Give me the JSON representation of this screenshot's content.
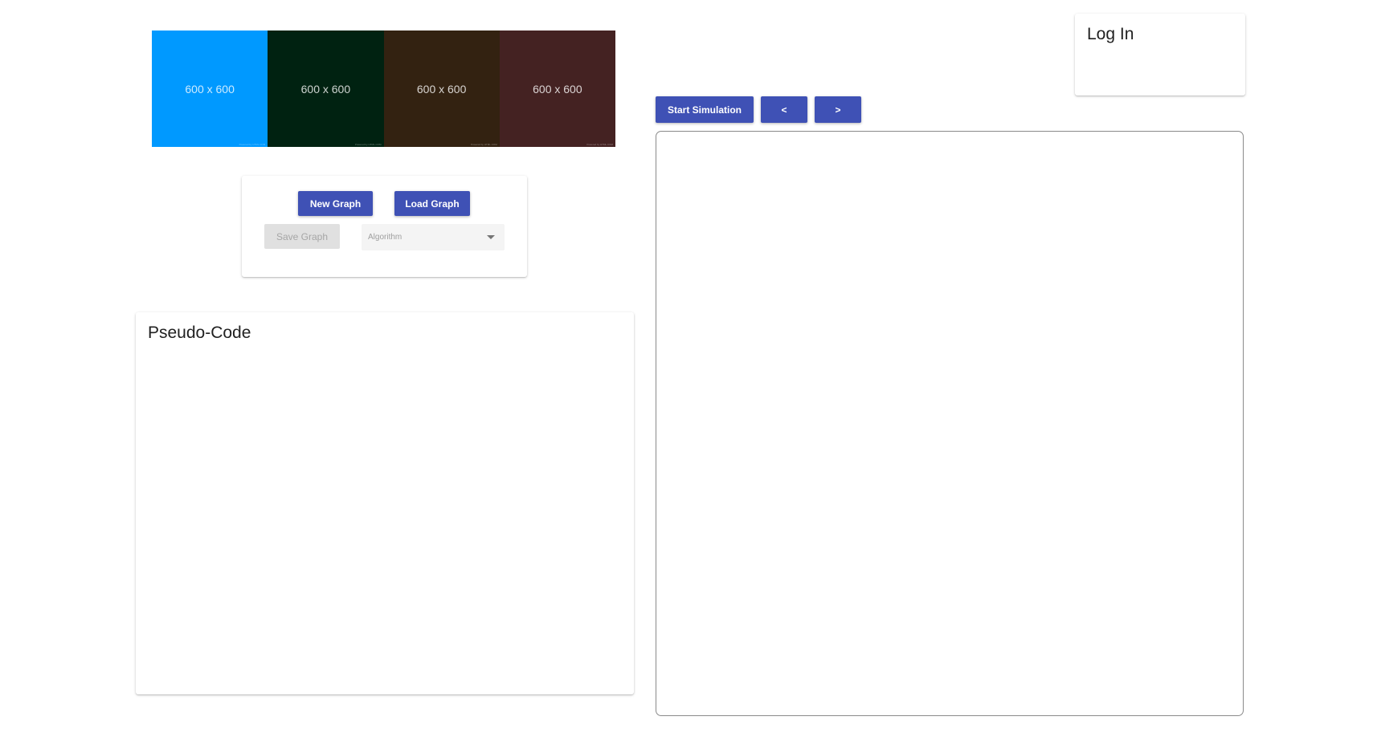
{
  "banner": {
    "tiles": [
      {
        "label": "600 x 600",
        "color": "#0099ff"
      },
      {
        "label": "600 x 600",
        "color": "#002211"
      },
      {
        "label": "600 x 600",
        "color": "#332211"
      },
      {
        "label": "600 x 600",
        "color": "#442222"
      }
    ],
    "credit": "Powered by HTML.COM"
  },
  "controls": {
    "new_graph_label": "New Graph",
    "load_graph_label": "Load Graph",
    "save_graph_label": "Save Graph",
    "algorithm_placeholder": "Algorithm"
  },
  "pseudo_code": {
    "title": "Pseudo-Code"
  },
  "login": {
    "title": "Log In"
  },
  "simulation": {
    "start_label": "Start Simulation",
    "prev_label": "<",
    "next_label": ">"
  },
  "colors": {
    "primary": "#3f51b5",
    "disabled_bg": "#e0e0e0"
  }
}
